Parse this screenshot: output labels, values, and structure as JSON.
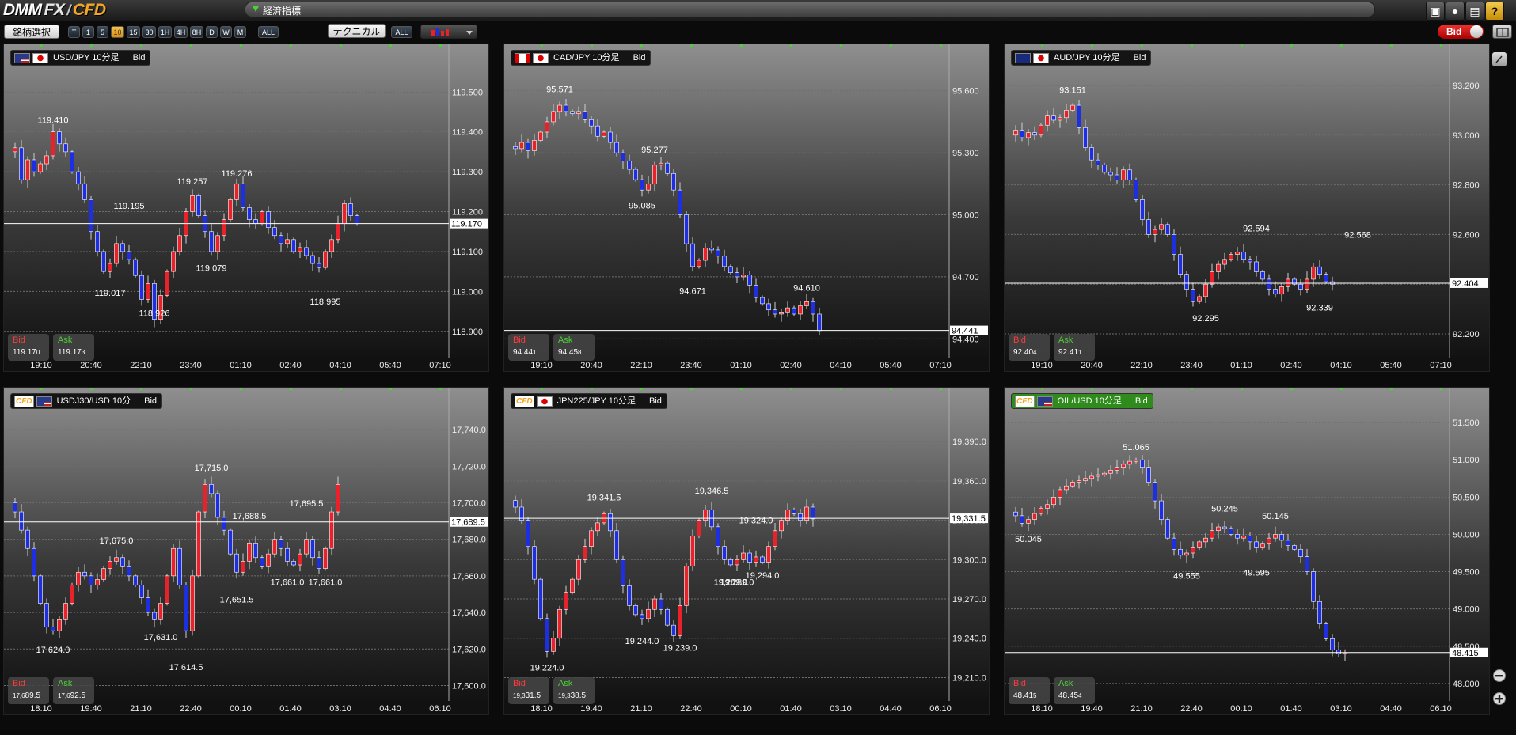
{
  "app": {
    "logo_a": "DMM",
    "logo_b": "FX",
    "logo_sep": "/",
    "logo_c": "CFD"
  },
  "news": {
    "label": "経済指標"
  },
  "toolbar": {
    "symbol_select": "銘柄選択",
    "timeframes": [
      "T",
      "1",
      "5",
      "10",
      "15",
      "30",
      "1H",
      "4H",
      "8H",
      "D",
      "W",
      "M"
    ],
    "active_timeframe": "10",
    "all": "ALL",
    "technical": "テクニカル",
    "technical_all": "ALL",
    "bid_toggle": "Bid"
  },
  "colors": {
    "up": "#e8212a",
    "down": "#1d2fe0",
    "doji": "#d4c21a",
    "grid": "#6d6d6d",
    "price_line": "#ffffff",
    "bid": "#ff3b3b",
    "ask": "#4cd137"
  },
  "charts": [
    {
      "pair": "USD/JPY 10分足",
      "side": "Bid",
      "flags": [
        "us",
        "jp"
      ],
      "cfd": false,
      "y_min": 118.85,
      "y_max": 119.56,
      "ticks": [
        "119.500",
        "119.400",
        "119.300",
        "119.200",
        "119.100",
        "119.000",
        "118.900"
      ],
      "tick_vals": [
        119.5,
        119.4,
        119.3,
        119.2,
        119.1,
        119.0,
        118.9
      ],
      "current": "119.170",
      "current_val": 119.17,
      "x_labels": [
        "19:10",
        "20:40",
        "22:10",
        "23:40",
        "01:10",
        "02:40",
        "04:10",
        "05:40",
        "07:10"
      ],
      "labels": [
        {
          "t": "119.410",
          "v": 119.41,
          "i": 7
        },
        {
          "t": "119.195",
          "v": 119.195,
          "i": 19
        },
        {
          "t": "119.017",
          "v": 119.017,
          "i": 16
        },
        {
          "t": "118.926",
          "v": 118.926,
          "i": 23
        },
        {
          "t": "119.257",
          "v": 119.257,
          "i": 29
        },
        {
          "t": "119.276",
          "v": 119.276,
          "i": 36
        },
        {
          "t": "119.079",
          "v": 119.079,
          "i": 32
        },
        {
          "t": "118.995",
          "v": 118.995,
          "i": 50
        }
      ],
      "path": [
        119.35,
        119.36,
        119.28,
        119.33,
        119.3,
        119.32,
        119.34,
        119.4,
        119.37,
        119.35,
        119.3,
        119.27,
        119.23,
        119.15,
        119.1,
        119.05,
        119.07,
        119.12,
        119.1,
        119.08,
        119.04,
        118.98,
        119.02,
        118.93,
        118.99,
        119.05,
        119.1,
        119.14,
        119.2,
        119.24,
        119.19,
        119.15,
        119.1,
        119.14,
        119.18,
        119.23,
        119.27,
        119.21,
        119.18,
        119.17,
        119.2,
        119.16,
        119.14,
        119.12,
        119.13,
        119.1,
        119.11,
        119.09,
        119.07,
        119.06,
        119.1,
        119.13,
        119.17,
        119.22,
        119.19,
        119.17
      ],
      "bid_main": "119.17",
      "bid_sub": "0",
      "bid_pre": "",
      "ask_main": "119.17",
      "ask_sub": "3",
      "ask_pre": ""
    },
    {
      "pair": "CAD/JPY 10分足",
      "side": "Bid",
      "flags": [
        "ca",
        "jp"
      ],
      "cfd": false,
      "y_min": 94.34,
      "y_max": 95.71,
      "ticks": [
        "95.600",
        "95.300",
        "95.000",
        "94.700",
        "94.400"
      ],
      "tick_vals": [
        95.6,
        95.3,
        95.0,
        94.7,
        94.4
      ],
      "current": "94.441",
      "current_val": 94.441,
      "x_labels": [
        "19:10",
        "20:40",
        "22:10",
        "23:40",
        "01:10",
        "02:40",
        "04:10",
        "05:40",
        "07:10"
      ],
      "labels": [
        {
          "t": "95.571",
          "v": 95.571,
          "i": 8
        },
        {
          "t": "95.277",
          "v": 95.277,
          "i": 23
        },
        {
          "t": "95.085",
          "v": 95.085,
          "i": 21
        },
        {
          "t": "94.671",
          "v": 94.671,
          "i": 29
        },
        {
          "t": "94.610",
          "v": 94.61,
          "i": 47
        }
      ],
      "path": [
        95.33,
        95.32,
        95.35,
        95.31,
        95.36,
        95.4,
        95.45,
        95.5,
        95.53,
        95.5,
        95.49,
        95.5,
        95.46,
        95.43,
        95.38,
        95.4,
        95.35,
        95.3,
        95.26,
        95.22,
        95.17,
        95.12,
        95.15,
        95.24,
        95.25,
        95.2,
        95.12,
        95.0,
        94.86,
        94.75,
        94.78,
        94.84,
        94.83,
        94.8,
        94.75,
        94.72,
        94.7,
        94.71,
        94.66,
        94.6,
        94.57,
        94.54,
        94.52,
        94.53,
        94.55,
        94.52,
        94.56,
        94.58,
        94.52,
        94.44
      ],
      "bid_main": "94.44",
      "bid_sub": "1",
      "bid_pre": "",
      "ask_main": "94.45",
      "ask_sub": "8",
      "ask_pre": ""
    },
    {
      "pair": "AUD/JPY 10分足",
      "side": "Bid",
      "flags": [
        "au",
        "jp"
      ],
      "cfd": false,
      "y_min": 92.13,
      "y_max": 93.27,
      "ticks": [
        "93.200",
        "93.000",
        "92.800",
        "92.600",
        "92.400",
        "92.200"
      ],
      "tick_vals": [
        93.2,
        93.0,
        92.8,
        92.6,
        92.4,
        92.2
      ],
      "current": "92.404",
      "current_val": 92.404,
      "x_labels": [
        "19:10",
        "20:40",
        "22:10",
        "23:40",
        "01:10",
        "02:40",
        "04:10",
        "05:40",
        "07:10"
      ],
      "labels": [
        {
          "t": "93.151",
          "v": 93.151,
          "i": 10
        },
        {
          "t": "92.594",
          "v": 92.594,
          "i": 39
        },
        {
          "t": "92.295",
          "v": 92.295,
          "i": 31
        },
        {
          "t": "92.339",
          "v": 92.339,
          "i": 49
        },
        {
          "t": "92.568",
          "v": 92.568,
          "i": 55
        }
      ],
      "path": [
        93.0,
        93.02,
        92.99,
        93.01,
        93.0,
        93.04,
        93.08,
        93.06,
        93.07,
        93.1,
        93.12,
        93.03,
        92.95,
        92.9,
        92.88,
        92.85,
        92.84,
        92.82,
        92.86,
        92.82,
        92.74,
        92.66,
        92.6,
        92.62,
        92.64,
        92.6,
        92.52,
        92.44,
        92.38,
        92.33,
        92.35,
        92.4,
        92.45,
        92.48,
        92.5,
        92.52,
        92.53,
        92.5,
        92.49,
        92.45,
        92.42,
        92.38,
        92.36,
        92.39,
        92.42,
        92.4,
        92.38,
        92.42,
        92.47,
        92.44,
        92.41,
        92.4
      ],
      "bid_main": "92.40",
      "bid_sub": "4",
      "bid_pre": "",
      "ask_main": "92.41",
      "ask_sub": "1",
      "ask_pre": ""
    },
    {
      "pair": "USDJ30/USD 10分",
      "side": "Bid",
      "flags": [
        "us"
      ],
      "cfd": true,
      "y_min": 17595,
      "y_max": 17750,
      "ticks": [
        "17,740.0",
        "17,720.0",
        "17,700.0",
        "17,680.0",
        "17,660.0",
        "17,640.0",
        "17,620.0",
        "17,600.0"
      ],
      "tick_vals": [
        17740,
        17720,
        17700,
        17680,
        17660,
        17640,
        17620,
        17600
      ],
      "current": "17,689.5",
      "current_val": 17689.5,
      "x_labels": [
        "18:10",
        "19:40",
        "21:10",
        "22:40",
        "00:10",
        "01:40",
        "03:10",
        "04:40",
        "06:10"
      ],
      "labels": [
        {
          "t": "17,624.0",
          "v": 17624,
          "i": 7
        },
        {
          "t": "17,675.0",
          "v": 17675,
          "i": 17
        },
        {
          "t": "17,631.0",
          "v": 17631,
          "i": 24
        },
        {
          "t": "17,614.5",
          "v": 17614.5,
          "i": 28
        },
        {
          "t": "17,715.0",
          "v": 17715,
          "i": 32
        },
        {
          "t": "17,688.5",
          "v": 17688.5,
          "i": 38
        },
        {
          "t": "17,651.5",
          "v": 17651.5,
          "i": 36
        },
        {
          "t": "17,695.5",
          "v": 17695.5,
          "i": 47
        },
        {
          "t": "17,661.0",
          "v": 17661,
          "i": 44
        },
        {
          "t": "17,661.0",
          "v": 17661,
          "i": 50
        }
      ],
      "path": [
        17700,
        17695,
        17685,
        17675,
        17660,
        17645,
        17632,
        17630,
        17636,
        17645,
        17655,
        17662,
        17660,
        17655,
        17658,
        17664,
        17668,
        17670,
        17665,
        17660,
        17655,
        17648,
        17640,
        17636,
        17645,
        17660,
        17675,
        17655,
        17630,
        17660,
        17695,
        17710,
        17705,
        17692,
        17685,
        17672,
        17662,
        17668,
        17678,
        17670,
        17665,
        17672,
        17680,
        17675,
        17668,
        17666,
        17672,
        17680,
        17670,
        17664,
        17675,
        17695,
        17710
      ],
      "bid_main": "89.5",
      "bid_sub": "",
      "bid_pre": "17,6",
      "ask_main": "92.5",
      "ask_sub": "",
      "ask_pre": "17,6"
    },
    {
      "pair": "JPN225/JPY 10分足",
      "side": "Bid",
      "flags": [
        "jp"
      ],
      "cfd": true,
      "y_min": 19197,
      "y_max": 19413,
      "ticks": [
        "19,390.0",
        "19,360.0",
        "19,330.0",
        "19,300.0",
        "19,270.0",
        "19,240.0",
        "19,210.0"
      ],
      "tick_vals": [
        19390,
        19360,
        19330,
        19300,
        19270,
        19240,
        19210
      ],
      "current": "19,331.5",
      "current_val": 19331.5,
      "x_labels": [
        "18:10",
        "19:40",
        "21:10",
        "22:40",
        "00:10",
        "01:40",
        "03:10",
        "04:40",
        "06:10"
      ],
      "labels": [
        {
          "t": "19,224.0",
          "v": 19224,
          "i": 6
        },
        {
          "t": "19,341.5",
          "v": 19341.5,
          "i": 15
        },
        {
          "t": "19,244.0",
          "v": 19244,
          "i": 21
        },
        {
          "t": "19,239.0",
          "v": 19239,
          "i": 27
        },
        {
          "t": "19,346.5",
          "v": 19346.5,
          "i": 32
        },
        {
          "t": "19,324.0",
          "v": 19324,
          "i": 39
        },
        {
          "t": "19,289.0",
          "v": 19289,
          "i": 35
        },
        {
          "t": "19,294.0",
          "v": 19294,
          "i": 40
        },
        {
          "t": "19,289.0",
          "v": 19289,
          "i": 36
        }
      ],
      "path": [
        19345,
        19340,
        19330,
        19310,
        19285,
        19255,
        19230,
        19240,
        19262,
        19275,
        19285,
        19300,
        19310,
        19322,
        19328,
        19335,
        19322,
        19300,
        19280,
        19265,
        19258,
        19255,
        19262,
        19270,
        19262,
        19250,
        19242,
        19265,
        19295,
        19318,
        19330,
        19338,
        19325,
        19310,
        19300,
        19296,
        19300,
        19305,
        19298,
        19302,
        19298,
        19310,
        19322,
        19330,
        19338,
        19335,
        19330,
        19340,
        19331
      ],
      "bid_main": "31.5",
      "bid_sub": "",
      "bid_pre": "19,3",
      "ask_main": "38.5",
      "ask_sub": "",
      "ask_pre": "19,3"
    },
    {
      "pair": "OIL/USD 10分足",
      "side": "Bid",
      "flags": [
        "us"
      ],
      "cfd": true,
      "green": true,
      "y_min": 47.85,
      "y_max": 51.65,
      "ticks": [
        "51.500",
        "51.000",
        "50.500",
        "50.000",
        "49.500",
        "49.000",
        "48.500",
        "48.000"
      ],
      "tick_vals": [
        51.5,
        51.0,
        50.5,
        50.0,
        49.5,
        49.0,
        48.5,
        48.0
      ],
      "current": "48.415",
      "current_val": 48.415,
      "x_labels": [
        "18:10",
        "19:40",
        "21:10",
        "22:40",
        "00:10",
        "01:40",
        "03:10",
        "04:40",
        "06:10"
      ],
      "labels": [
        {
          "t": "50.045",
          "v": 50.045,
          "i": 3
        },
        {
          "t": "51.065",
          "v": 51.065,
          "i": 20
        },
        {
          "t": "49.555",
          "v": 49.555,
          "i": 28
        },
        {
          "t": "50.245",
          "v": 50.245,
          "i": 34
        },
        {
          "t": "49.595",
          "v": 49.595,
          "i": 39
        },
        {
          "t": "50.145",
          "v": 50.145,
          "i": 42
        }
      ],
      "path": [
        50.3,
        50.25,
        50.15,
        50.2,
        50.28,
        50.35,
        50.4,
        50.5,
        50.6,
        50.65,
        50.7,
        50.72,
        50.75,
        50.78,
        50.8,
        50.82,
        50.86,
        50.9,
        50.94,
        50.98,
        51.0,
        50.9,
        50.7,
        50.45,
        50.2,
        49.95,
        49.8,
        49.72,
        49.75,
        49.82,
        49.9,
        49.95,
        50.05,
        50.1,
        50.08,
        50.0,
        49.95,
        49.98,
        49.9,
        49.82,
        49.88,
        49.95,
        50.0,
        49.92,
        49.85,
        49.8,
        49.7,
        49.5,
        49.1,
        48.8,
        48.6,
        48.45,
        48.4,
        48.41
      ],
      "bid_main": "48.41",
      "bid_sub": "5",
      "bid_pre": "",
      "ask_main": "48.45",
      "ask_sub": "4",
      "ask_pre": ""
    }
  ],
  "side_icons": [
    "pencil-icon",
    "minus-icon",
    "plus-icon"
  ]
}
